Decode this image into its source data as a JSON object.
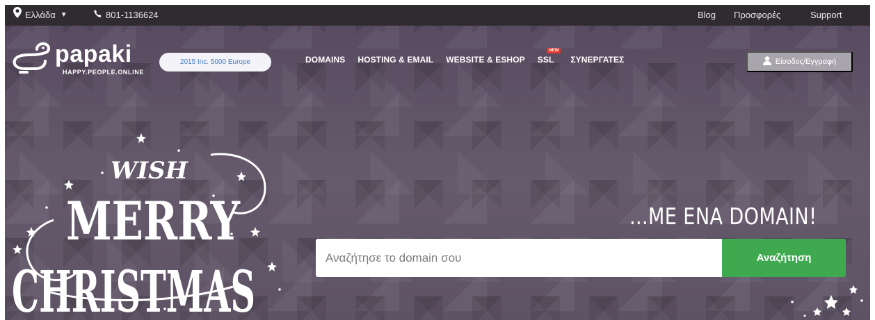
{
  "topbar": {
    "country": "Ελλάδα",
    "phone": "801-1136624",
    "links": [
      "Blog",
      "Προσφορές",
      "Support"
    ]
  },
  "header": {
    "logo_text": "papaki",
    "logo_tagline": "HAPPY.PEOPLE.ONLINE",
    "award_text": "2015 Inc. 5000 Europe",
    "nav": [
      "DOMAINS",
      "HOSTING & EMAIL",
      "WEBSITE & ESHOP",
      "SSL",
      "ΣΥΝΕΡΓΑΤΕΣ"
    ],
    "nav_badge": "NEW",
    "login_label": "Είσοδος/Εγγραφή"
  },
  "hero": {
    "xmas_lines": [
      "WISH",
      "MERRY",
      "CHRISTMAS"
    ],
    "tagline": "...ΜΕ ΕΝΑ DOMAIN!",
    "search_placeholder": "Αναζήτησε το domain σου",
    "search_button": "Αναζήτηση"
  },
  "colors": {
    "topbar_bg": "#2f2b31",
    "hero_bg": "#5f5468",
    "search_button": "#3fa950",
    "award_text": "#3f7ec6",
    "login_bg": "#a9a5ad"
  },
  "icons": {
    "country": "map-pin-icon",
    "phone": "phone-icon",
    "login": "user-icon",
    "dropdown": "caret-down-icon"
  }
}
